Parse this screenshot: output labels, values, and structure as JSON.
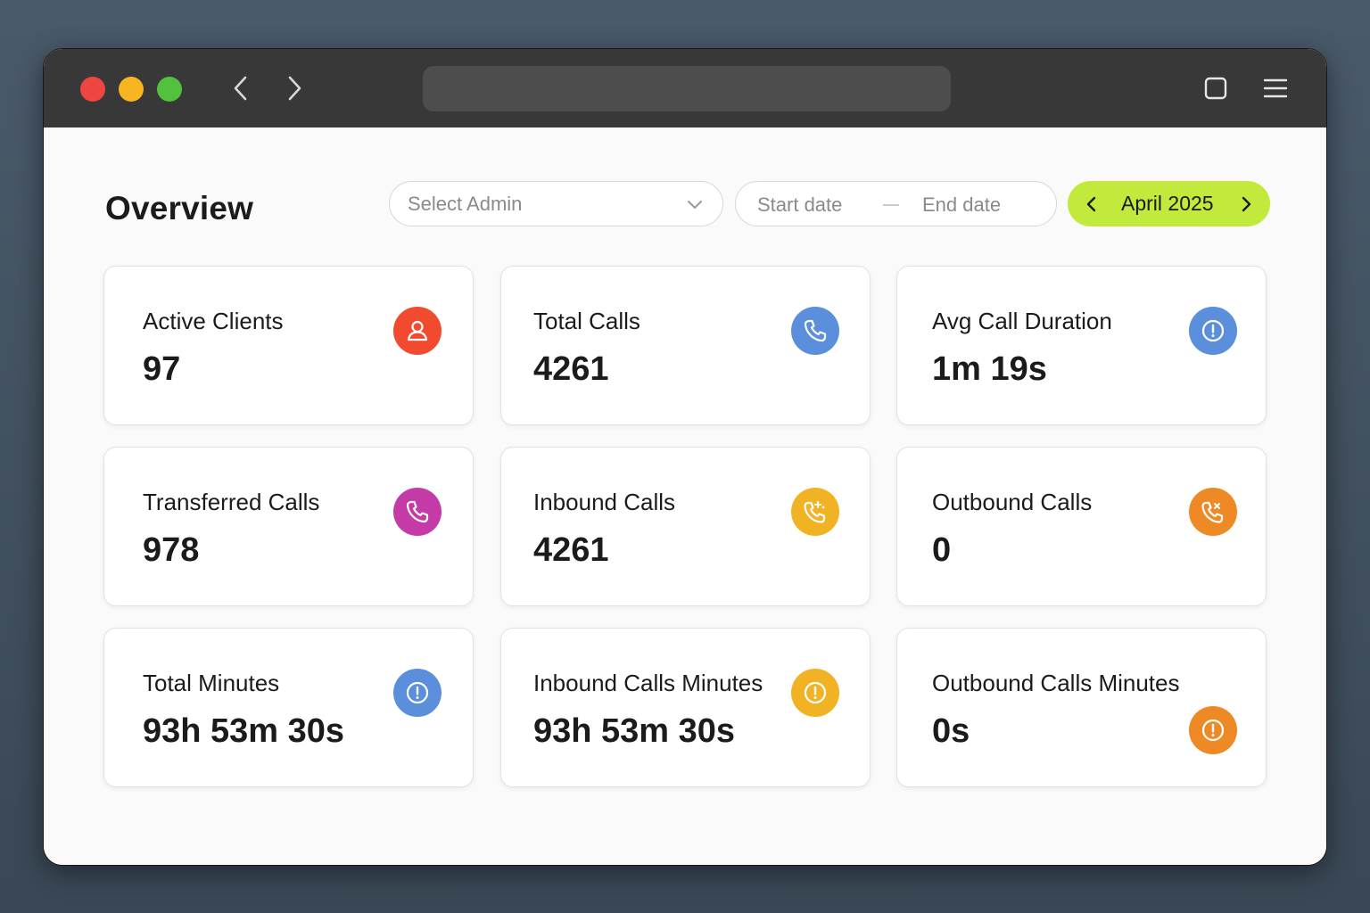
{
  "header": {
    "title": "Overview",
    "select_admin_placeholder": "Select Admin",
    "start_date_placeholder": "Start date",
    "end_date_placeholder": "End date",
    "month_label": "April 2025",
    "accent_color": "#c2ea3d"
  },
  "cards": [
    {
      "title": "Active Clients",
      "value": "97",
      "icon": "user-icon",
      "color": "#f24a2e"
    },
    {
      "title": "Total Calls",
      "value": "4261",
      "icon": "phone-icon",
      "color": "#5b8fdc"
    },
    {
      "title": "Avg Call Duration",
      "value": "1m 19s",
      "icon": "alert-icon",
      "color": "#5b8fdc"
    },
    {
      "title": "Transferred Calls",
      "value": "978",
      "icon": "phone-icon",
      "color": "#c43ba8"
    },
    {
      "title": "Inbound Calls",
      "value": "4261",
      "icon": "phone-incoming-icon",
      "color": "#f1b324"
    },
    {
      "title": "Outbound Calls",
      "value": "0",
      "icon": "phone-outgoing-icon",
      "color": "#ee8a25"
    },
    {
      "title": "Total Minutes",
      "value": "93h 53m 30s",
      "icon": "alert-icon",
      "color": "#5b8fdc"
    },
    {
      "title": "Inbound Calls Minutes",
      "value": "93h 53m 30s",
      "icon": "alert-icon",
      "color": "#f1b324"
    },
    {
      "title": "Outbound Calls Minutes",
      "value": "0s",
      "icon": "alert-icon",
      "color": "#ee8a25"
    }
  ]
}
